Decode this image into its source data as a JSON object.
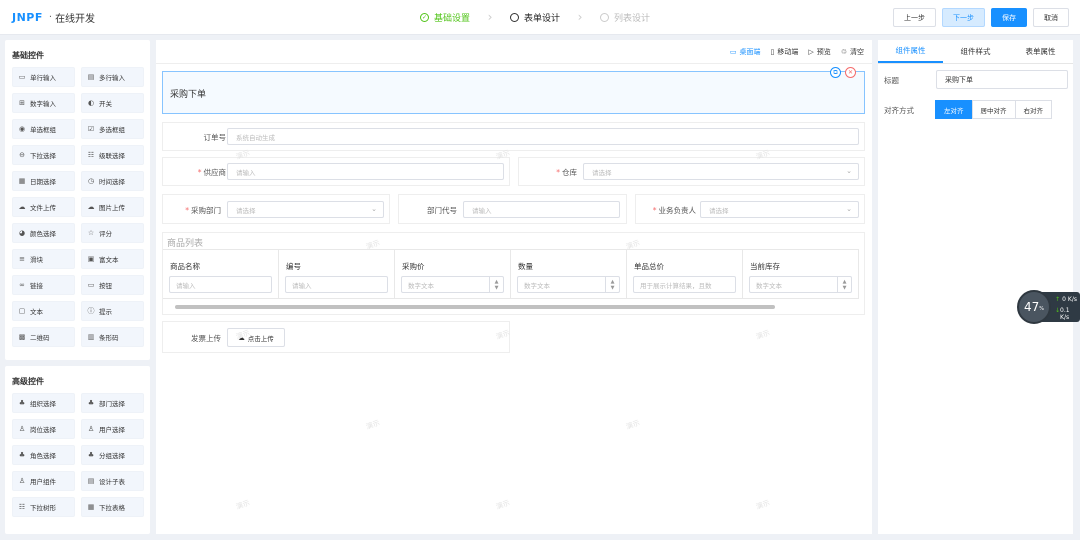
{
  "header": {
    "brand": "JNPF",
    "separator": "·",
    "app_title": "在线开发",
    "steps": [
      {
        "label": "基础设置",
        "state": "done"
      },
      {
        "label": "表单设计",
        "state": "active"
      },
      {
        "label": "列表设计",
        "state": "pending"
      }
    ],
    "buttons": {
      "prev": "上一步",
      "next": "下一步",
      "save": "保存",
      "cancel": "取消"
    }
  },
  "basic_controls": {
    "title": "基础控件",
    "items": [
      {
        "label": "单行输入",
        "icon": "single-line-input-icon",
        "glyph": "▭"
      },
      {
        "label": "多行输入",
        "icon": "multi-line-input-icon",
        "glyph": "▤"
      },
      {
        "label": "数字输入",
        "icon": "number-input-icon",
        "glyph": "⊞"
      },
      {
        "label": "开关",
        "icon": "switch-icon",
        "glyph": "◐"
      },
      {
        "label": "单选框组",
        "icon": "radio-icon",
        "glyph": "◉"
      },
      {
        "label": "多选框组",
        "icon": "checkbox-icon",
        "glyph": "☑"
      },
      {
        "label": "下拉选择",
        "icon": "select-icon",
        "glyph": "⊖"
      },
      {
        "label": "级联选择",
        "icon": "cascader-icon",
        "glyph": "☷"
      },
      {
        "label": "日期选择",
        "icon": "calendar-icon",
        "glyph": "▦"
      },
      {
        "label": "时间选择",
        "icon": "clock-icon",
        "glyph": "◷"
      },
      {
        "label": "文件上传",
        "icon": "upload-icon",
        "glyph": "☁"
      },
      {
        "label": "图片上传",
        "icon": "image-upload-icon",
        "glyph": "☁"
      },
      {
        "label": "颜色选择",
        "icon": "palette-icon",
        "glyph": "◕"
      },
      {
        "label": "评分",
        "icon": "star-icon",
        "glyph": "☆"
      },
      {
        "label": "滑块",
        "icon": "slider-icon",
        "glyph": "≡"
      },
      {
        "label": "富文本",
        "icon": "rich-text-icon",
        "glyph": "▣"
      },
      {
        "label": "链接",
        "icon": "link-icon",
        "glyph": "∞"
      },
      {
        "label": "按钮",
        "icon": "button-icon",
        "glyph": "▭"
      },
      {
        "label": "文本",
        "icon": "text-icon",
        "glyph": "▢"
      },
      {
        "label": "提示",
        "icon": "info-icon",
        "glyph": "ⓘ"
      },
      {
        "label": "二维码",
        "icon": "qrcode-icon",
        "glyph": "▩"
      },
      {
        "label": "条形码",
        "icon": "barcode-icon",
        "glyph": "▥"
      }
    ]
  },
  "advanced_controls": {
    "title": "高级控件",
    "items": [
      {
        "label": "组织选择",
        "icon": "organization-icon",
        "glyph": "♣"
      },
      {
        "label": "部门选择",
        "icon": "department-icon",
        "glyph": "♣"
      },
      {
        "label": "岗位选择",
        "icon": "position-icon",
        "glyph": "♙"
      },
      {
        "label": "用户选择",
        "icon": "user-icon",
        "glyph": "♙"
      },
      {
        "label": "角色选择",
        "icon": "role-icon",
        "glyph": "♣"
      },
      {
        "label": "分组选择",
        "icon": "group-icon",
        "glyph": "♣"
      },
      {
        "label": "用户组件",
        "icon": "user-component-icon",
        "glyph": "♙"
      },
      {
        "label": "设计子表",
        "icon": "subtable-icon",
        "glyph": "▤"
      },
      {
        "label": "下拉树形",
        "icon": "tree-select-icon",
        "glyph": "☷"
      },
      {
        "label": "下拉表格",
        "icon": "table-select-icon",
        "glyph": "▦"
      }
    ]
  },
  "toolbar": {
    "desktop": "桌面端",
    "mobile": "移动端",
    "preview": "预览",
    "clear": "清空"
  },
  "form": {
    "title_block": "采购下单",
    "order_no": {
      "label": "订单号",
      "placeholder": "系统自动生成"
    },
    "supplier": {
      "label": "供应商",
      "placeholder": "请输入"
    },
    "warehouse": {
      "label": "仓库",
      "placeholder": "请选择"
    },
    "purchase_dept": {
      "label": "采购部门",
      "placeholder": "请选择"
    },
    "dept_code": {
      "label": "部门代号",
      "placeholder": "请输入"
    },
    "owner": {
      "label": "业务负责人",
      "placeholder": "请选择"
    },
    "table_title": "商品列表",
    "columns": [
      {
        "header": "商品名称",
        "placeholder": "请输入",
        "spin": false
      },
      {
        "header": "编号",
        "placeholder": "请输入",
        "spin": false
      },
      {
        "header": "采购价",
        "placeholder": "数字文本",
        "spin": true
      },
      {
        "header": "数量",
        "placeholder": "数字文本",
        "spin": true
      },
      {
        "header": "单品总价",
        "placeholder": "用于展示计算结果，且数",
        "spin": false
      },
      {
        "header": "当前库存",
        "placeholder": "数字文本",
        "spin": true
      }
    ],
    "invoice_label": "发票上传",
    "upload_button": "点击上传",
    "watermark": "演示"
  },
  "right_panel": {
    "tabs": [
      "组件属性",
      "组件样式",
      "表单属性"
    ],
    "title_label": "标题",
    "title_value": "采购下单",
    "align_label": "对齐方式",
    "align_options": [
      "左对齐",
      "居中对齐",
      "右对齐"
    ]
  },
  "speed_widget": {
    "percent": "47",
    "unit": "%",
    "up": "0",
    "up_unit": "K/s",
    "down": "0.1",
    "down_unit": "K/s"
  }
}
